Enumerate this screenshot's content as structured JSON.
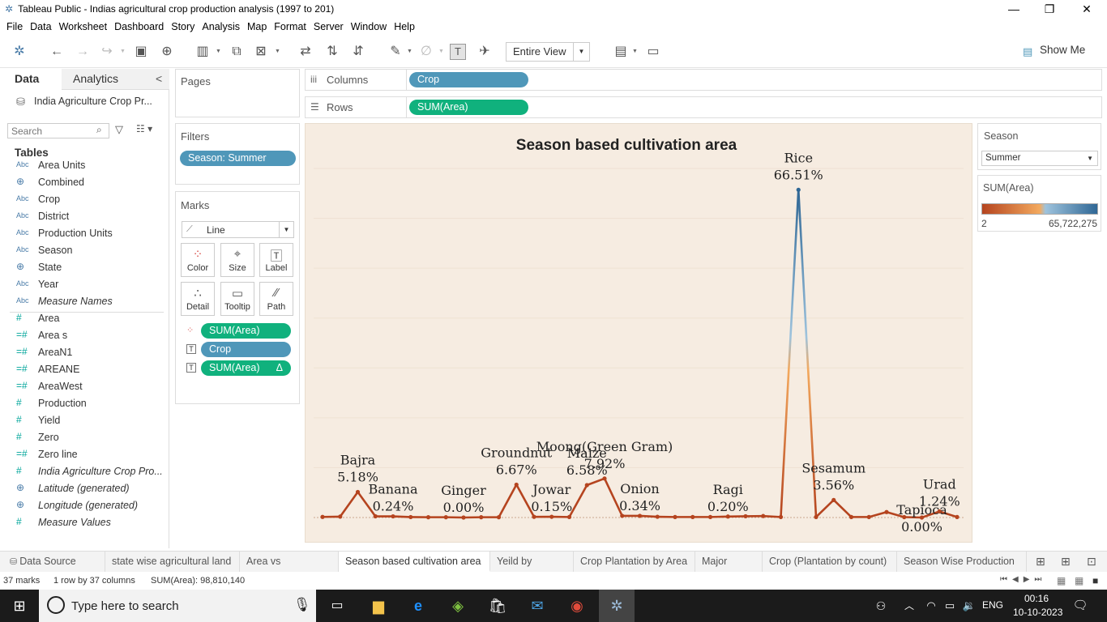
{
  "window": {
    "title": "Tableau Public - Indias agricultural crop production analysis (1997 to 201)",
    "minimize": "—",
    "restore": "❐",
    "close": "✕"
  },
  "menu": [
    "File",
    "Data",
    "Worksheet",
    "Dashboard",
    "Story",
    "Analysis",
    "Map",
    "Format",
    "Server",
    "Window",
    "Help"
  ],
  "toolbar": {
    "fit": "Entire View",
    "show_me": "Show Me"
  },
  "data_pane": {
    "tab_data": "Data",
    "tab_analytics": "Analytics",
    "collapse": "<",
    "datasource": "India Agriculture Crop Pr...",
    "search_placeholder": "Search",
    "tables_label": "Tables",
    "fields": [
      {
        "icon": "Abc",
        "name": "Area Units",
        "italic": false,
        "kind": "dim"
      },
      {
        "icon": "globe-icon",
        "name": "Combined",
        "italic": false,
        "kind": "geo"
      },
      {
        "icon": "Abc",
        "name": "Crop",
        "italic": false,
        "kind": "dim"
      },
      {
        "icon": "Abc",
        "name": "District",
        "italic": false,
        "kind": "dim"
      },
      {
        "icon": "Abc",
        "name": "Production Units",
        "italic": false,
        "kind": "dim"
      },
      {
        "icon": "Abc",
        "name": "Season",
        "italic": false,
        "kind": "dim"
      },
      {
        "icon": "globe-icon",
        "name": "State",
        "italic": false,
        "kind": "geo"
      },
      {
        "icon": "Abc",
        "name": "Year",
        "italic": false,
        "kind": "dim"
      },
      {
        "icon": "Abc",
        "name": "Measure Names",
        "italic": true,
        "kind": "dim"
      },
      {
        "icon": "#",
        "name": "Area",
        "italic": false,
        "kind": "measure"
      },
      {
        "icon": "=#",
        "name": "Area s",
        "italic": false,
        "kind": "measure"
      },
      {
        "icon": "=#",
        "name": "AreaN1",
        "italic": false,
        "kind": "measure"
      },
      {
        "icon": "=#",
        "name": "AREANE",
        "italic": false,
        "kind": "measure"
      },
      {
        "icon": "=#",
        "name": "AreaWest",
        "italic": false,
        "kind": "measure"
      },
      {
        "icon": "#",
        "name": "Production",
        "italic": false,
        "kind": "measure"
      },
      {
        "icon": "#",
        "name": "Yield",
        "italic": false,
        "kind": "measure"
      },
      {
        "icon": "#",
        "name": "Zero",
        "italic": false,
        "kind": "measure"
      },
      {
        "icon": "=#",
        "name": "Zero line",
        "italic": false,
        "kind": "measure"
      },
      {
        "icon": "#",
        "name": "India Agriculture Crop Pro...",
        "italic": true,
        "kind": "measure"
      },
      {
        "icon": "globe-icon",
        "name": "Latitude (generated)",
        "italic": true,
        "kind": "geo"
      },
      {
        "icon": "globe-icon",
        "name": "Longitude (generated)",
        "italic": true,
        "kind": "geo"
      },
      {
        "icon": "#",
        "name": "Measure Values",
        "italic": true,
        "kind": "measure"
      }
    ]
  },
  "shelves": {
    "pages_label": "Pages",
    "columns_label": "Columns",
    "columns_pill": "Crop",
    "rows_label": "Rows",
    "rows_pill": "SUM(Area)",
    "filters_label": "Filters",
    "filter_pill": "Season: Summer",
    "marks_label": "Marks",
    "mark_type": "Line",
    "mark_buttons": [
      "Color",
      "Size",
      "Label",
      "Detail",
      "Tooltip",
      "Path"
    ],
    "mark_pills": [
      {
        "label": "SUM(Area)",
        "color": "green",
        "icon": "color-dots-icon",
        "suffix": ""
      },
      {
        "label": "Crop",
        "color": "blue",
        "icon": "T",
        "suffix": ""
      },
      {
        "label": "SUM(Area)",
        "color": "green",
        "icon": "T",
        "suffix": "Δ"
      }
    ]
  },
  "season_filter": {
    "label": "Season",
    "value": "Summer"
  },
  "color_legend": {
    "label": "SUM(Area)",
    "min": "2",
    "max": "65,722,275",
    "low_color": "#b5441f",
    "mid_color": "#f3a95e",
    "high_color": "#2f6795"
  },
  "chart_data": {
    "type": "line",
    "title": "Season based cultivation area",
    "xlabel": "",
    "ylabel": "",
    "ylim": [
      0,
      70000000
    ],
    "grid": true,
    "legend": "right",
    "points": [
      {
        "value": 120000,
        "label": ""
      },
      {
        "value": 180000,
        "label": ""
      },
      {
        "value": 5118000,
        "label": "Bajra\n5.18%"
      },
      {
        "value": 240000,
        "label": ""
      },
      {
        "value": 237000,
        "label": "Banana\n0.24%"
      },
      {
        "value": 90000,
        "label": ""
      },
      {
        "value": 60000,
        "label": ""
      },
      {
        "value": 60000,
        "label": ""
      },
      {
        "value": 2000,
        "label": "Ginger\n0.00%"
      },
      {
        "value": 60000,
        "label": ""
      },
      {
        "value": 60000,
        "label": ""
      },
      {
        "value": 6590000,
        "label": "Groundnut\n6.67%"
      },
      {
        "value": 140000,
        "label": ""
      },
      {
        "value": 148000,
        "label": "Jowar\n0.15%"
      },
      {
        "value": 100000,
        "label": ""
      },
      {
        "value": 6497000,
        "label": "Maize\n6.58%"
      },
      {
        "value": 7825000,
        "label": "Moong(Green Gram)\n7.92%"
      },
      {
        "value": 336000,
        "label": ""
      },
      {
        "value": 336000,
        "label": "Onion\n0.34%"
      },
      {
        "value": 150000,
        "label": ""
      },
      {
        "value": 100000,
        "label": ""
      },
      {
        "value": 100000,
        "label": ""
      },
      {
        "value": 100000,
        "label": ""
      },
      {
        "value": 198000,
        "label": "Ragi\n0.20%"
      },
      {
        "value": 250000,
        "label": ""
      },
      {
        "value": 300000,
        "label": ""
      },
      {
        "value": 100000,
        "label": ""
      },
      {
        "value": 65722275,
        "label": "Rice\n66.51%"
      },
      {
        "value": 100000,
        "label": ""
      },
      {
        "value": 3517000,
        "label": "Sesamum\n3.56%"
      },
      {
        "value": 100000,
        "label": ""
      },
      {
        "value": 100000,
        "label": ""
      },
      {
        "value": 1100000,
        "label": ""
      },
      {
        "value": 80000,
        "label": ""
      },
      {
        "value": 2000,
        "label": "Tapioca\n0.00%"
      },
      {
        "value": 1225000,
        "label": "Urad\n1.24%"
      },
      {
        "value": 100000,
        "label": ""
      }
    ]
  },
  "sheet_tabs": [
    {
      "label": "Data Source",
      "active": false
    },
    {
      "label": "state wise agricultural land",
      "active": false
    },
    {
      "label": "Area vs Production",
      "active": false
    },
    {
      "label": "Season based cultivation area",
      "active": true
    },
    {
      "label": "Yeild by season",
      "active": false
    },
    {
      "label": "Crop Plantation by Area",
      "active": false
    },
    {
      "label": "Major Crops",
      "active": false
    },
    {
      "label": "Crop (Plantation by count)",
      "active": false
    },
    {
      "label": "Season Wise Production",
      "active": false
    }
  ],
  "status": {
    "marks": "37 marks",
    "grid": "1 row by 37 columns",
    "sum": "SUM(Area): 98,810,140"
  },
  "taskbar": {
    "search_placeholder": "Type here to search",
    "lang": "ENG",
    "time": "00:16",
    "date": "10-10-2023"
  }
}
